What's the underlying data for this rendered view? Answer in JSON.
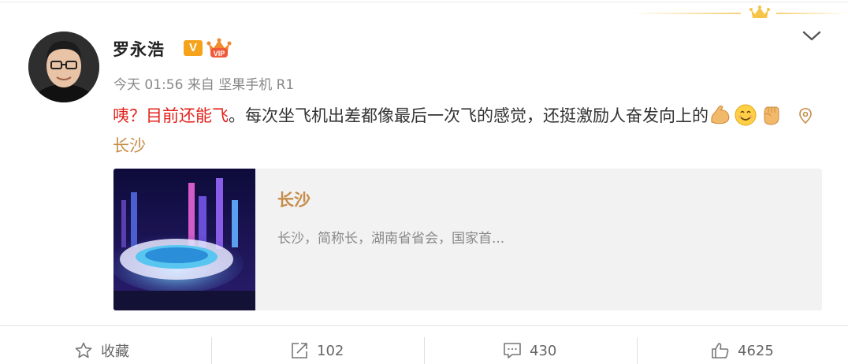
{
  "user": {
    "name": "罗永浩",
    "verified_badge": "V",
    "vip_badge_icon": "crown-vip-icon"
  },
  "meta": {
    "time": "今天 01:56",
    "source_prefix": "来自",
    "source": "坚果手机 R1"
  },
  "post": {
    "highlight": "咦？目前还能飞",
    "text": "。每次坐飞机出差都像最后一次飞的感觉，还挺激励人奋发向上的",
    "emojis": [
      "flexed-biceps-icon",
      "smiling-face-icon",
      "raised-fist-icon"
    ],
    "location": "长沙"
  },
  "link_card": {
    "title": "长沙",
    "description": "长沙，简称长，湖南省省会，国家首..."
  },
  "actions": {
    "favorite": "收藏",
    "repost_count": "102",
    "comment_count": "430",
    "like_count": "4625"
  },
  "colors": {
    "highlight": "#e3231d",
    "location": "#c68c4a",
    "badge": "#f4a31a"
  }
}
